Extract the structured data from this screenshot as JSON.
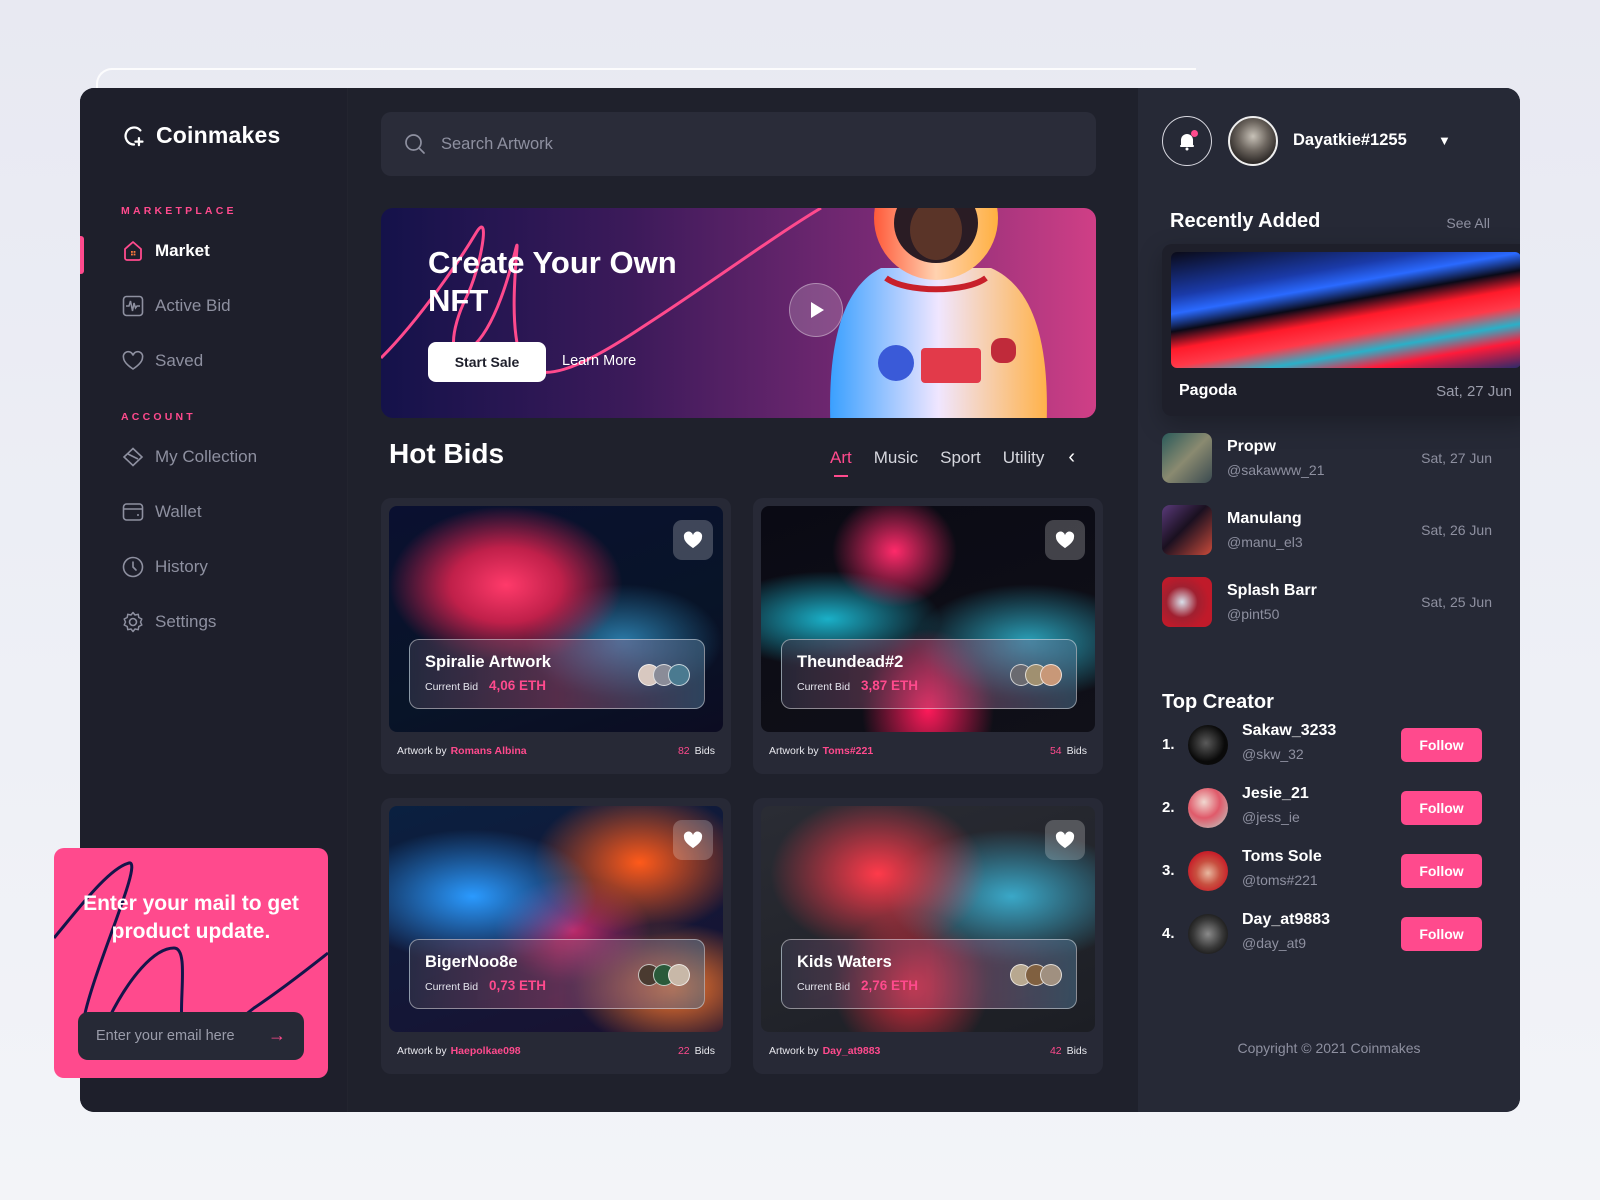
{
  "brand": {
    "name": "Coinmakes",
    "accent": "#ff4a8d"
  },
  "sidebar": {
    "sections": [
      {
        "label": "MARKETPLACE",
        "items": [
          {
            "label": "Market",
            "icon": "home-icon",
            "active": true
          },
          {
            "label": "Active Bid",
            "icon": "activity-icon",
            "active": false
          },
          {
            "label": "Saved",
            "icon": "heart-icon",
            "active": false
          }
        ]
      },
      {
        "label": "ACCOUNT",
        "items": [
          {
            "label": "My Collection",
            "icon": "collection-icon",
            "active": false
          },
          {
            "label": "Wallet",
            "icon": "wallet-icon",
            "active": false
          },
          {
            "label": "History",
            "icon": "clock-icon",
            "active": false
          },
          {
            "label": "Settings",
            "icon": "gear-icon",
            "active": false
          }
        ]
      }
    ]
  },
  "subscribe": {
    "title": "Enter your mail to get product update.",
    "placeholder": "Enter your email here",
    "submit_icon": "arrow-right-icon"
  },
  "search": {
    "placeholder": "Search Artwork",
    "icon": "search-icon"
  },
  "hero": {
    "title": "Create Your Own NFT",
    "primary_button": "Start Sale",
    "secondary_button": "Learn More",
    "play_icon": "play-icon"
  },
  "hot_bids": {
    "title": "Hot Bids",
    "tabs": [
      {
        "label": "Art",
        "active": true
      },
      {
        "label": "Music",
        "active": false
      },
      {
        "label": "Sport",
        "active": false
      },
      {
        "label": "Utility",
        "active": false
      }
    ],
    "prev_icon": "chevron-left-icon",
    "current_bid_label": "Current Bid",
    "artwork_by_label": "Artwork by",
    "bids_suffix": "Bids",
    "cards": [
      {
        "name": "Spiralie Artwork",
        "bid": "4,06 ETH",
        "artist": "Romans Albina",
        "bids": "82"
      },
      {
        "name": "Theundead#2",
        "bid": "3,87 ETH",
        "artist": "Toms#221",
        "bids": "54"
      },
      {
        "name": "BigerNoo8e",
        "bid": "0,73 ETH",
        "artist": "Haepolkae098",
        "bids": "22"
      },
      {
        "name": "Kids Waters",
        "bid": "2,76 ETH",
        "artist": "Day_at9883",
        "bids": "42"
      }
    ]
  },
  "header": {
    "user_name": "Dayatkie#1255",
    "bell_icon": "bell-icon",
    "has_notification": true,
    "caret_icon": "caret-down-icon"
  },
  "recently_added": {
    "title": "Recently Added",
    "see_all": "See All",
    "featured": {
      "name": "Pagoda",
      "date": "Sat, 27 Jun"
    },
    "items": [
      {
        "name": "Propw",
        "handle": "@sakawww_21",
        "date": "Sat, 27 Jun"
      },
      {
        "name": "Manulang",
        "handle": "@manu_el3",
        "date": "Sat, 26 Jun"
      },
      {
        "name": "Splash Barr",
        "handle": "@pint50",
        "date": "Sat, 25 Jun"
      }
    ]
  },
  "top_creator": {
    "title": "Top Creator",
    "follow_label": "Follow",
    "creators": [
      {
        "rank": "1.",
        "name": "Sakaw_3233",
        "handle": "@skw_32"
      },
      {
        "rank": "2.",
        "name": "Jesie_21",
        "handle": "@jess_ie"
      },
      {
        "rank": "3.",
        "name": "Toms Sole",
        "handle": "@toms#221"
      },
      {
        "rank": "4.",
        "name": "Day_at9883",
        "handle": "@day_at9"
      }
    ]
  },
  "footer": {
    "copyright": "Copyright © 2021 Coinmakes"
  }
}
